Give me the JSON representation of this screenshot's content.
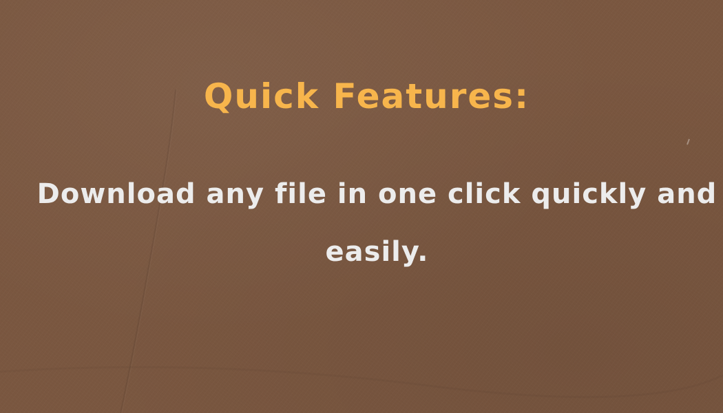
{
  "slide": {
    "title": "Quick Features:",
    "body": "Download any file in one click quickly and easily."
  },
  "colors": {
    "background": "#7a5740",
    "title": "#f7b54c",
    "body": "#ececec"
  }
}
